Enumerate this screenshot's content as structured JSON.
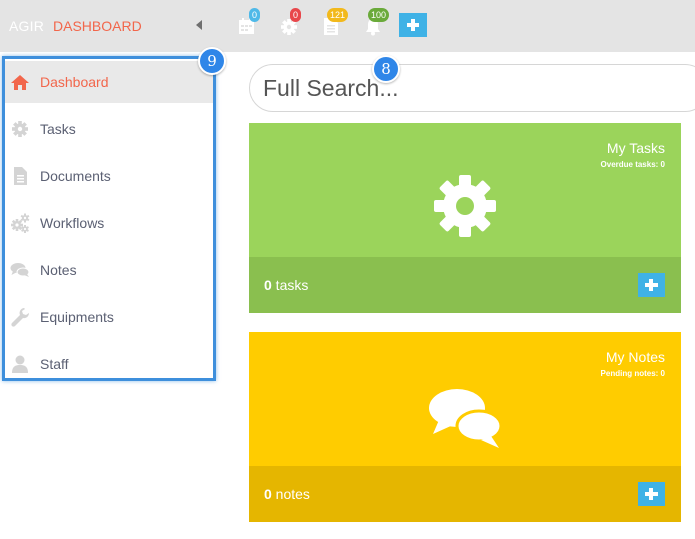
{
  "topbar": {
    "brand": "AGIR",
    "crumb": "DASHBOARD",
    "icons": [
      {
        "name": "calendar-icon",
        "badge": "0",
        "badge_color": "#4fb9e8"
      },
      {
        "name": "gear-icon",
        "badge": "0",
        "badge_color": "#e8474b"
      },
      {
        "name": "document-icon",
        "badge": "121",
        "badge_color": "#f2b91c"
      },
      {
        "name": "bell-icon",
        "badge": "100",
        "badge_color": "#6aaa3a"
      }
    ]
  },
  "sidebar": {
    "items": [
      {
        "label": "Dashboard",
        "icon": "home-icon",
        "active": true
      },
      {
        "label": "Tasks",
        "icon": "gear-icon"
      },
      {
        "label": "Documents",
        "icon": "document-icon"
      },
      {
        "label": "Workflows",
        "icon": "gears-icon"
      },
      {
        "label": "Notes",
        "icon": "comments-icon"
      },
      {
        "label": "Equipments",
        "icon": "wrench-icon"
      },
      {
        "label": "Staff",
        "icon": "user-icon"
      }
    ]
  },
  "callouts": {
    "sidebar": "9",
    "search": "8"
  },
  "search": {
    "placeholder": "Full Search..."
  },
  "cards": [
    {
      "title": "My Tasks",
      "subtitle": "Overdue tasks: 0",
      "count": "0",
      "count_label": " tasks",
      "top_color": "#9bd45b",
      "bottom_color": "#8abf4f",
      "icon": "gear-icon"
    },
    {
      "title": "My Notes",
      "subtitle": "Pending notes: 0",
      "count": "0",
      "count_label": " notes",
      "top_color": "#ffcc00",
      "bottom_color": "#e5b600",
      "icon": "comments-icon"
    }
  ],
  "colors": {
    "accent": "#f2664b",
    "add_button": "#3fb2e6",
    "callout": "#2f86e8"
  }
}
